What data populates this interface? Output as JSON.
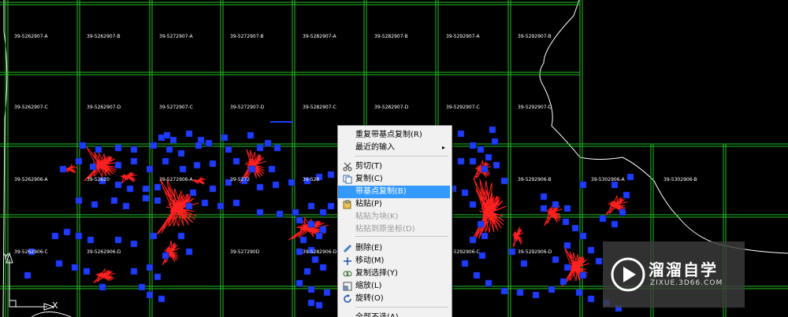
{
  "grid": {
    "rows": [
      [
        "39-5262907-A",
        "39-5262907-B",
        "39-5272907-A",
        "39-5272907-B",
        "39-5282907-A",
        "39-5282907-B",
        "39-5292907-A",
        "39-5292907-B"
      ],
      [
        "39-5262907-C",
        "39-5262907-D",
        "39-5272907-C",
        "39-5272907-D",
        "39-5282907-C",
        "39-5282907-D",
        "39-5292907-C",
        "39-5292907-D"
      ],
      [
        "39-5262906-A",
        "39-52620",
        "39-5272906-A",
        "39-5272",
        "39-528",
        "",
        "",
        "39-5292906-B",
        "39-5302906-A",
        "39-5302906-B"
      ],
      [
        "39-5262906-C",
        "39-5262906-D",
        "",
        "39-527290D",
        "39-5282906-D",
        "",
        "39-5292906-C",
        "39-5292906-D"
      ]
    ]
  },
  "context_menu": {
    "items": [
      {
        "label": "重复带基点复制(R)",
        "icon": "",
        "disabled": false,
        "highlight": false
      },
      {
        "label": "最近的输入",
        "icon": "",
        "disabled": false,
        "highlight": false,
        "submenu": true
      },
      {
        "label": "剪切(T)",
        "icon": "scissors-icon",
        "disabled": false,
        "highlight": false
      },
      {
        "label": "复制(C)",
        "icon": "copy-icon",
        "disabled": false,
        "highlight": false
      },
      {
        "label": "带基点复制(B)",
        "icon": "",
        "disabled": false,
        "highlight": true
      },
      {
        "label": "粘贴(P)",
        "icon": "paste-icon",
        "disabled": false,
        "highlight": false
      },
      {
        "label": "粘贴为块(K)",
        "icon": "",
        "disabled": true,
        "highlight": false
      },
      {
        "label": "粘贴到原坐标(D)",
        "icon": "",
        "disabled": true,
        "highlight": false
      },
      {
        "label": "删除(E)",
        "icon": "eraser-icon",
        "disabled": false,
        "highlight": false
      },
      {
        "label": "移动(M)",
        "icon": "move-icon",
        "disabled": false,
        "highlight": false
      },
      {
        "label": "复制选择(Y)",
        "icon": "copy-select-icon",
        "disabled": false,
        "highlight": false
      },
      {
        "label": "缩放(L)",
        "icon": "scale-icon",
        "disabled": false,
        "highlight": false
      },
      {
        "label": "旋转(O)",
        "icon": "rotate-icon",
        "disabled": false,
        "highlight": false
      },
      {
        "label": "全部不选(A)",
        "icon": "",
        "disabled": false,
        "highlight": false
      }
    ]
  },
  "ucs": {
    "x_label": "X",
    "y_label": "Y"
  },
  "watermark": {
    "title": "溜溜自学",
    "subtitle": "ZIXUE.3D66.COM"
  },
  "colors": {
    "grid": "#22c022",
    "boundary": "#ffffff",
    "grips": "#1e3cff",
    "features": "#ff2020",
    "menu_highlight": "#3399ff"
  }
}
